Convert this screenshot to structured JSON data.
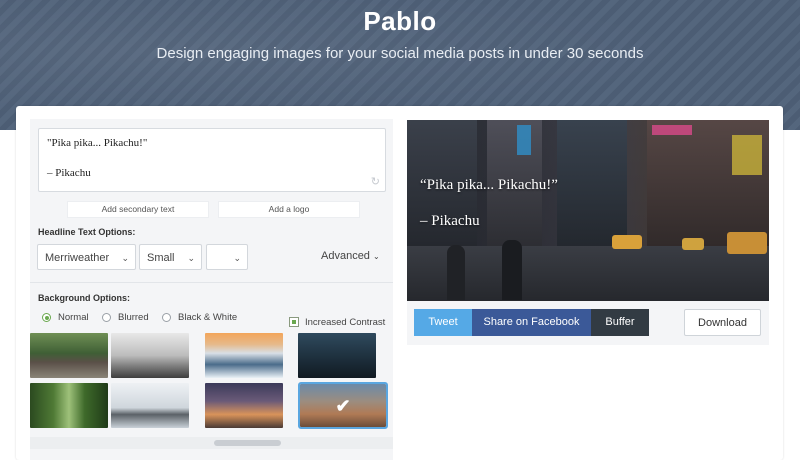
{
  "header": {
    "title": "Pablo",
    "tagline": "Design engaging images for your social media posts in under 30 seconds"
  },
  "editor": {
    "quote_line": "\"Pika pika... Pikachu!\"",
    "author_line": "– Pikachu",
    "refresh_icon": "refresh-icon",
    "add_secondary_label": "Add secondary text",
    "add_logo_label": "Add a logo"
  },
  "headline_options": {
    "label": "Headline Text Options:",
    "font_value": "Merriweather",
    "size_value": "Small",
    "color_value": "",
    "advanced_label": "Advanced",
    "chevron_icon": "chevron-down-icon"
  },
  "background_options": {
    "label": "Background Options:",
    "filters": [
      {
        "label": "Normal",
        "selected": true
      },
      {
        "label": "Blurred",
        "selected": false
      },
      {
        "label": "Black & White",
        "selected": false
      }
    ],
    "increased_contrast_label": "Increased Contrast",
    "increased_contrast_checked": true,
    "selected_thumbnail": "dry grass at dusk",
    "thumbnails": [
      "railway tracks in forest",
      "foggy landscape",
      "snowy trees at sunset",
      "night sky",
      "green forest",
      "misty rocky coast",
      "street lights at dusk",
      "dry grass at dusk"
    ]
  },
  "preview": {
    "quote": "“Pika pika... Pikachu!”",
    "author": "– Pikachu",
    "scene": "busy city street at night"
  },
  "share": {
    "tweet_label": "Tweet",
    "facebook_label": "Share on Facebook",
    "buffer_label": "Buffer",
    "download_label": "Download"
  },
  "colors": {
    "header_bg": "#4e6078",
    "tweet": "#55a9e6",
    "facebook": "#3b5998",
    "buffer": "#323b43",
    "radio_selected": "#6aa84f",
    "thumb_selected_outline": "#5aa6e0"
  }
}
